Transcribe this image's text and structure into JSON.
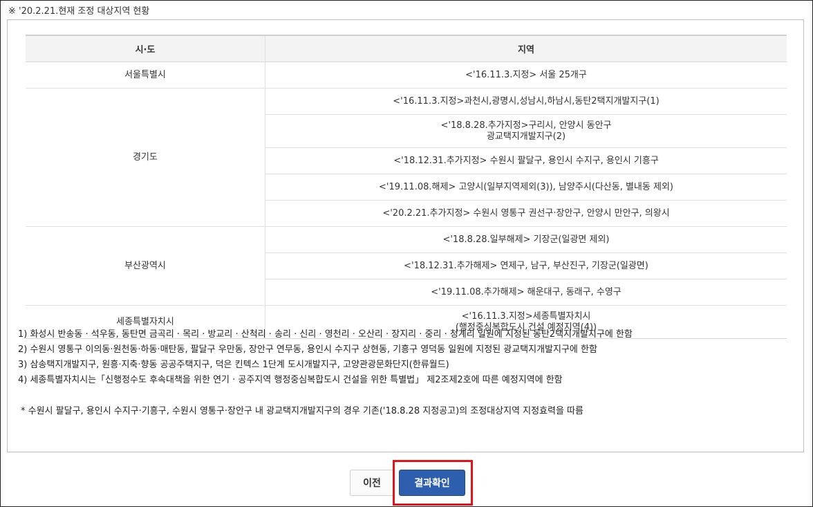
{
  "heading": "※ '20.2.21.현재 조정 대상지역 현황",
  "table": {
    "headers": [
      "시·도",
      "지역"
    ],
    "regions": [
      {
        "name": "서울특별시",
        "entries": [
          "<'16.11.3.지정> 서울 25개구"
        ]
      },
      {
        "name": "경기도",
        "entries": [
          "<'16.11.3.지정>과천시,광명시,성남시,하남시,동탄2택지개발지구(1)",
          "<'18.8.28.추가지정>구리시, 안양시 동안구",
          "광교택지개발지구(2)",
          "<'18.12.31.추가지정> 수원시 팔달구, 용인시 수지구, 용인시 기흥구",
          "<'19.11.08.해제> 고양시(일부지역제외(3)), 남양주시(다산동, 별내동 제외)",
          "<'20.2.21.추가지정> 수원시 영통구 권선구·장안구, 안양시 만안구, 의왕시"
        ]
      },
      {
        "name": "부산광역시",
        "entries": [
          "<'18.8.28.일부해제> 기장군(일광면 제외)",
          "<'18.12.31.추가해제> 연제구, 남구, 부산진구, 기장군(일광면)",
          "<'19.11.08.추가해제> 해운대구, 동래구, 수영구"
        ]
      },
      {
        "name": "세종특별자치시",
        "entries": [
          "<'16.11.3.지정>세종특별자치시",
          "(행정중심복합도시 건설 예정지역(4))"
        ]
      }
    ]
  },
  "notes": [
    "1) 화성시 반송동 · 석우동, 동탄면 금곡리 · 목리 · 방교리 · 산척리 · 송리 · 신리 · 영천리 · 오산리 · 장지리 · 중리 · 청계리 일원에 지정된 동탄2택지개발지구에 한함",
    "2) 수원시 영통구 이의동·원천동·하동·매탄동, 팔달구 우만동, 장안구 연무동, 용인시 수지구 상현동, 기흥구 영덕동 일원에 지정된 광교택지개발지구에 한함",
    "3) 삼송택지개발지구, 원흥·지축·향동 공공주택지구, 덕은 킨텍스 1단계 도시개발지구, 고양관광문화단지(한류월드)",
    "4) 세종특별자치시는「신행정수도 후속대책을 위한 연기 · 공주지역 행정중심복합도시 건설을 위한 특별법」 제2조제2호에 따른 예정지역에 한함"
  ],
  "footnote": "* 수원시 팔달구, 용인시 수지구·기흥구, 수원시 영통구·장안구 내 광교택지개발지구의 경우 기존('18.8.28 지정공고)의 조정대상지역 지정효력을 따름",
  "buttons": {
    "prev": "이전",
    "confirm": "결과확인"
  },
  "colors": {
    "confirm_button": "#2d5fae",
    "highlight_border": "#e5141c",
    "header_bg": "#f3f3f3"
  }
}
